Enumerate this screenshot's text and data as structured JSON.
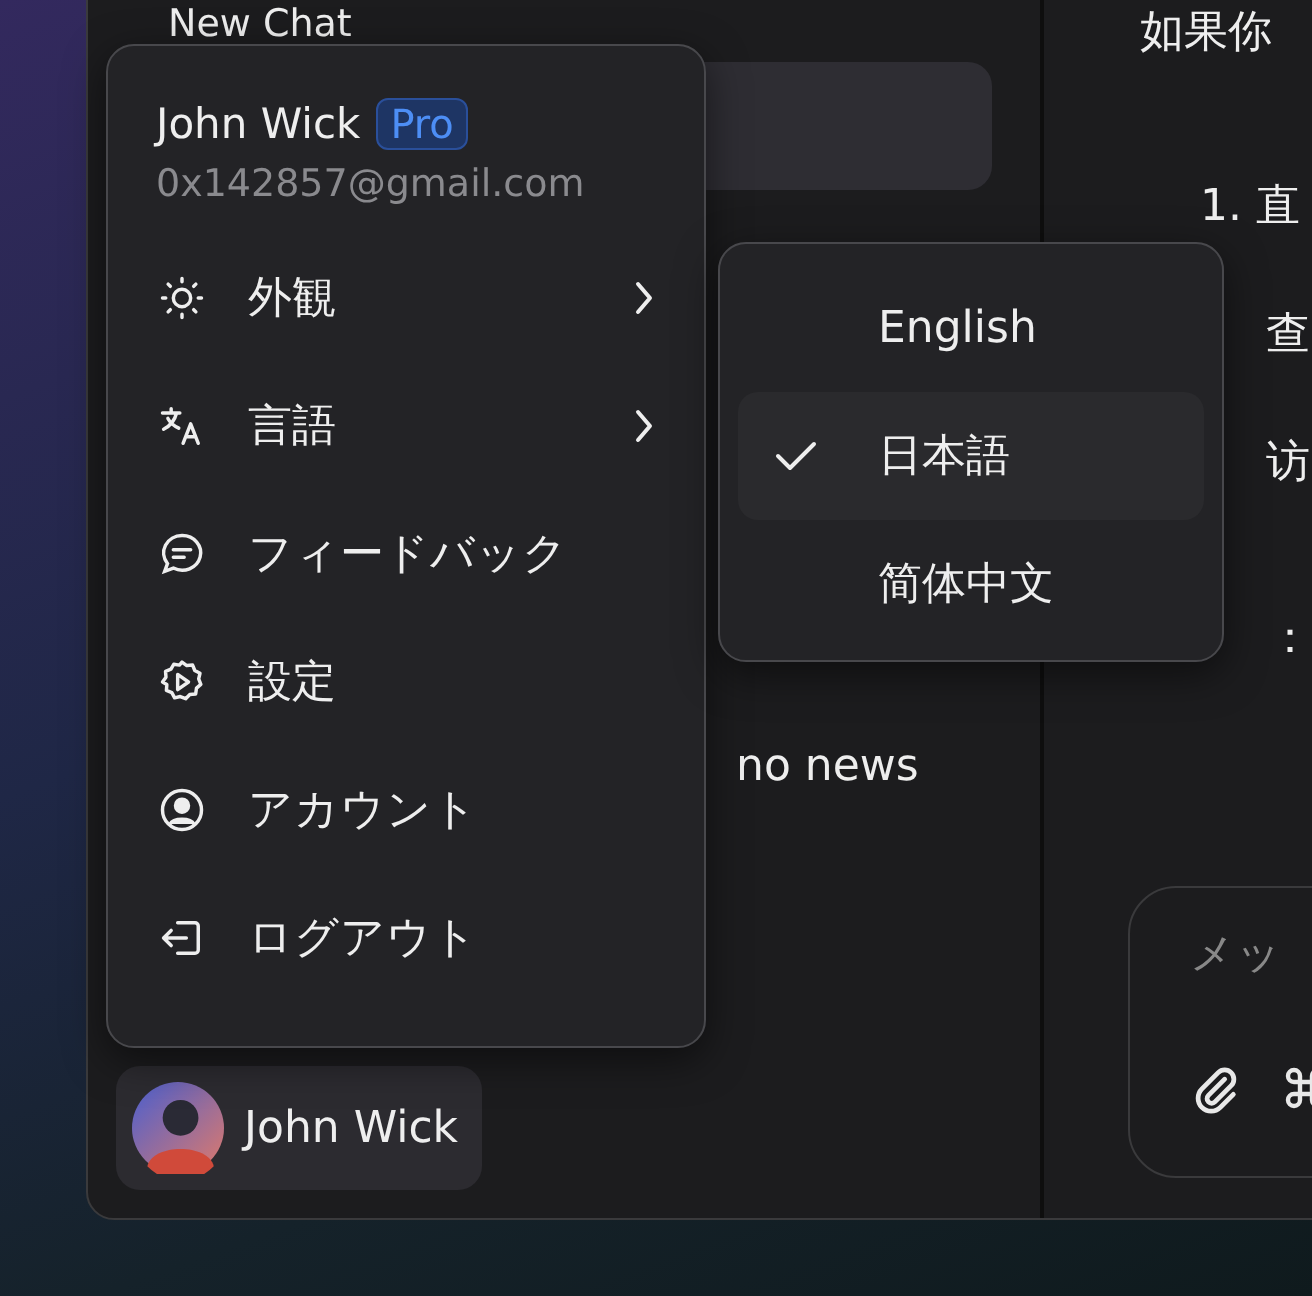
{
  "sidebar": {
    "new_chat": "New Chat",
    "history_item": "no news"
  },
  "chat": {
    "lines": [
      "如果你",
      "1. 直",
      "查",
      "访",
      "："
    ],
    "composer": {
      "placeholder": "メッ"
    }
  },
  "account_menu": {
    "name": "John Wick",
    "badge": "Pro",
    "email": "0x142857@gmail.com",
    "items": [
      {
        "kind": "appearance",
        "label": "外観",
        "has_submenu": true
      },
      {
        "kind": "language",
        "label": "言語",
        "has_submenu": true
      },
      {
        "kind": "feedback",
        "label": "フィードバック",
        "has_submenu": false
      },
      {
        "kind": "settings",
        "label": "設定",
        "has_submenu": false
      },
      {
        "kind": "account",
        "label": "アカウント",
        "has_submenu": false
      },
      {
        "kind": "logout",
        "label": "ログアウト",
        "has_submenu": false
      }
    ]
  },
  "language_menu": {
    "items": [
      {
        "label": "English",
        "selected": false
      },
      {
        "label": "日本語",
        "selected": true
      },
      {
        "label": "简体中文",
        "selected": false
      }
    ]
  },
  "user_button": {
    "name": "John Wick"
  }
}
